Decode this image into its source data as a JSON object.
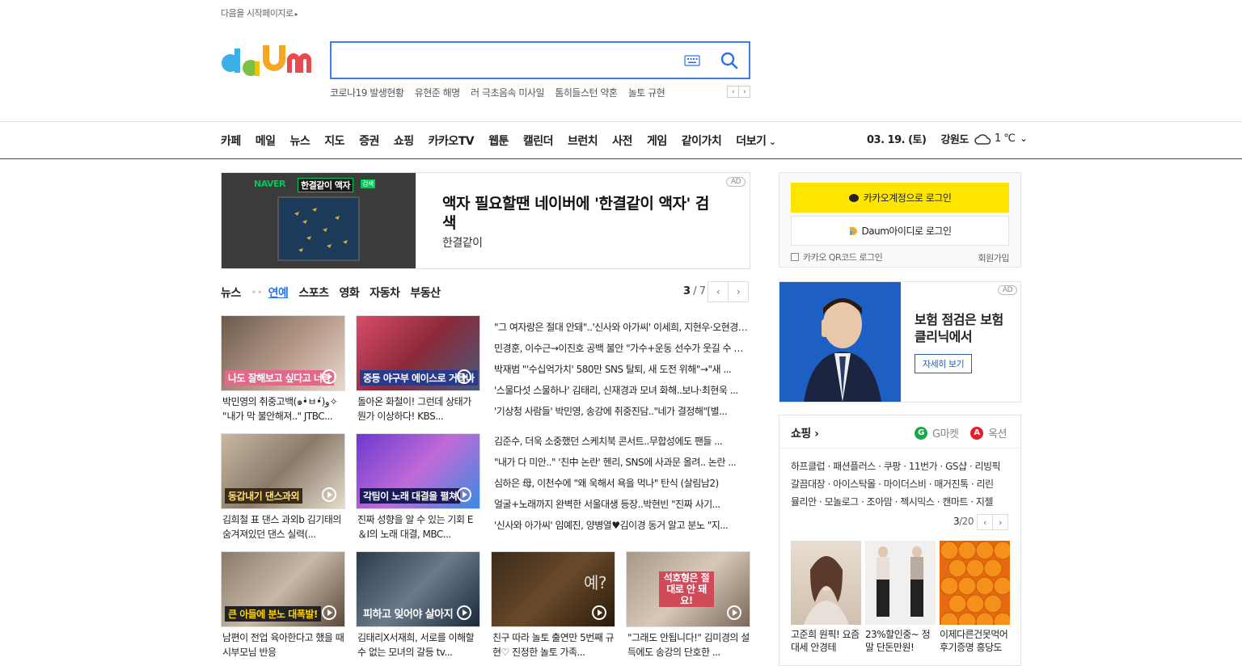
{
  "top_link": "다음을 시작페이지로",
  "search": {
    "value": "",
    "placeholder": ""
  },
  "trending": [
    "코로나19 발생현황",
    "유현준 해명",
    "러 극초음속 미사일",
    "톰히들스턴 약혼",
    "놀토 규현"
  ],
  "gnb": {
    "items": [
      "카페",
      "메일",
      "뉴스",
      "지도",
      "증권",
      "쇼핑",
      "카카오TV",
      "웹툰",
      "캘린더",
      "브런치",
      "사전",
      "게임",
      "같이가치",
      "더보기"
    ],
    "date": "03. 19. (토)",
    "region": "강원도",
    "temp": "1 ℃"
  },
  "ad_banner": {
    "title": "액자 필요할땐 네이버에 '한결같이 액자' 검색",
    "sub": "한결같이",
    "tag": "AD",
    "image_text": "한결같이 액자",
    "image_brand": "NAVER",
    "image_badge": "검색"
  },
  "news": {
    "tabs": [
      "뉴스",
      "연예",
      "스포츠",
      "영화",
      "자동차",
      "부동산"
    ],
    "active_tab": "연예",
    "page_current": "3",
    "page_total": "/ 7",
    "thumbs": [
      {
        "caption": "박민영의 취중고백(๑•̀ㅂ•́)و✧ \"내가 막 불안해져..\" JTBC...",
        "overlay": "나도 잘해보고 싶다고 너랑"
      },
      {
        "caption": "돌아온 화철이! 그런데 상태가 뭔가 이상하다! KBS...",
        "overlay": "중등 야구부 에이스로 거듭나"
      },
      {
        "caption": "김희철 표 댄스 과외b 김기태의 숨겨져있던 댄스 실력(...",
        "overlay": "동갑내기 댄스과외"
      },
      {
        "caption": "진짜 성향을 알 수 있는 기회 E＆I의 노래 대결, MBC...",
        "overlay": "각팀이 노래 대결을 펼쳐"
      },
      {
        "caption": "남편이 전업 육아한다고 했을 때 시부모님 반응",
        "overlay": "큰 아들에 분노 대폭발!"
      },
      {
        "caption": "김태리X서재희, 서로를 이해할 수 없는 모녀의 갈등 tv...",
        "overlay": "피하고 잊어야 살아지"
      },
      {
        "caption": "친구 따라 놀토 출연만 5번째 규현♡ 진정한 놀토 가족...",
        "overlay": "예?"
      },
      {
        "caption": "\"그래도 안됩니다!\" 김미경의 설득에도 송강의 단호한 ...",
        "overlay": "석호형은 절대로 안 돼요!"
      }
    ],
    "headlines_a": [
      "\"그 여자랑은 절대 안돼\"..'신사와 아가씨' 이세희, 지현우·오현경 관계 알고...",
      "민경훈, 이수근→이진호 공백 불안 \"가수+운동 선수가 웃길 수 있어?\"",
      "박재범 \"'수십억가치' 580만 SNS 탈퇴, 새 도전 위해\"→\"새 ...",
      "'스물다섯 스물하나' 김태리, 신재경과 모녀 화해..보나·최현욱 ...",
      "'기상청 사람들' 박민영, 송강에 취중진담..\"네가 결정해\"[별..."
    ],
    "headlines_b": [
      "김준수, 더욱 소중했던 스케치북 콘서트..무합성에도 팬들 ...",
      "\"내가 다 미안..\" '친中 논란' 헨리, SNS에 사과문 올려.. 논란 ...",
      "심하은 母, 이천수에 \"왜 욱해서 욕을 먹나\" 탄식 (살림남2)",
      "얼굴+노래까지 완벽한 서울대생 등장..박현빈 \"진짜 사기...",
      "'신사와 아가씨' 임예진, 양병열♥김이경 동거 알고 분노 \"지..."
    ]
  },
  "login": {
    "kakao": "카카오계정으로 로그인",
    "daum": "Daum아이디로 로그인",
    "qr": "카카오 QR코드 로그인",
    "signup": "회원가입"
  },
  "side_ad": {
    "title": "보험 점검은 보험클리닉에서",
    "button": "자세히 보기",
    "tag": "AD"
  },
  "shopping": {
    "title": "쇼핑",
    "partners": [
      "G마켓",
      "옥션"
    ],
    "links": [
      "하프클럽 · 패션플러스 · 쿠팡 · 11번가 · GS샵 · 리빙픽",
      "갈끔대장 · 아이스탁몰 · 마이더스비 · 매거진톡 · 리린",
      "뮬리안 · 모놀로그 · 조아맘 · 젝시믹스 · 캔마트 · 지젤"
    ],
    "page_current": "3",
    "page_total": "/20",
    "products": [
      {
        "caption": "고준희 원픽! 요즘대세 안경테"
      },
      {
        "caption": "23%할인중~ 정말 단돈만원!"
      },
      {
        "caption": "이제다른건못먹어 후기증명 흥당도"
      }
    ]
  },
  "colors": {
    "accent": "#2a73e6",
    "kakao": "#fee500",
    "search_border": "#3c7ee8"
  }
}
